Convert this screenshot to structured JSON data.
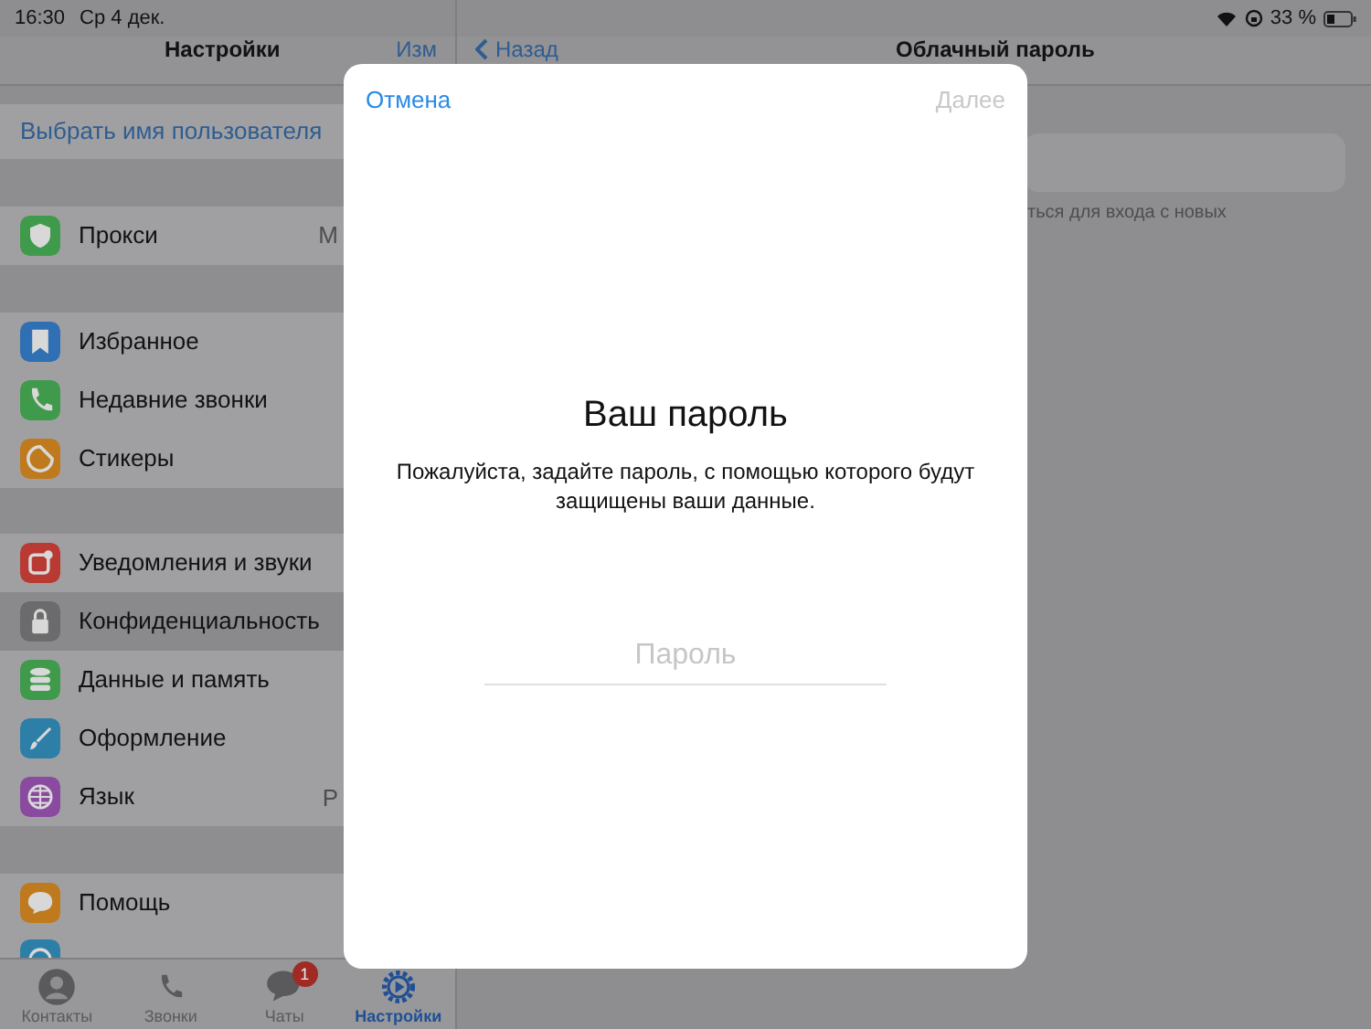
{
  "status_bar": {
    "time": "16:30",
    "date": "Ср 4 дек.",
    "battery": "33 %"
  },
  "sidebar": {
    "title": "Настройки",
    "edit": "Изм",
    "username_link": "Выбрать имя пользователя",
    "sections": [
      [
        {
          "color": "#3f9b4b",
          "label": "Прокси",
          "value": "М",
          "selected": false
        }
      ],
      [
        {
          "color": "#2f6fb3",
          "label": "Избранное",
          "selected": false
        },
        {
          "color": "#3f9b4b",
          "label": "Недавние звонки",
          "selected": false
        },
        {
          "color": "#c07a1e",
          "label": "Стикеры",
          "selected": false
        }
      ],
      [
        {
          "color": "#b93a33",
          "label": "Уведомления и звуки",
          "selected": false
        },
        {
          "color": "#6b6b6e",
          "label": "Конфиденциальность",
          "selected": true
        },
        {
          "color": "#3f9b4b",
          "label": "Данные и память",
          "selected": false
        },
        {
          "color": "#2e7fa8",
          "label": "Оформление",
          "selected": false
        },
        {
          "color": "#8a4a9f",
          "label": "Язык",
          "value": "Р",
          "selected": false
        }
      ],
      [
        {
          "color": "#c07a1e",
          "label": "Помощь",
          "selected": false
        },
        {
          "color": "#2e7fa8",
          "selected": false
        }
      ]
    ]
  },
  "tab_bar": [
    {
      "label": "Контакты",
      "selected": false
    },
    {
      "label": "Звонки",
      "selected": false
    },
    {
      "label": "Чаты",
      "badge": "1",
      "selected": false
    },
    {
      "label": "Настройки",
      "selected": true
    }
  ],
  "detail": {
    "back": "Назад",
    "title": "Облачный пароль",
    "footer": "ться для входа с новых"
  },
  "modal": {
    "cancel": "Отмена",
    "next": "Далее",
    "next_disabled": true,
    "title": "Ваш пароль",
    "description": "Пожалуйста, задайте пароль, с помощью которого будут защищены ваши данные.",
    "password": {
      "placeholder": "Пароль"
    }
  }
}
